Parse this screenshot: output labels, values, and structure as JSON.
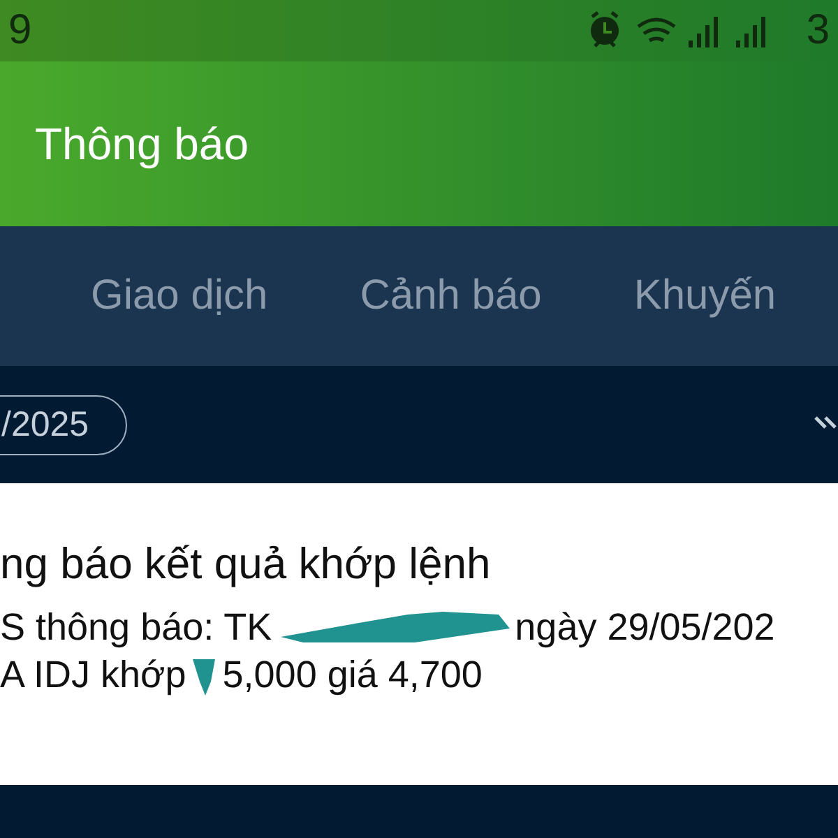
{
  "status_bar": {
    "time": "9",
    "battery": "3"
  },
  "header": {
    "title": "Thông báo"
  },
  "tabs": [
    {
      "label": "Giao dịch",
      "selected": false
    },
    {
      "label": "Cảnh báo",
      "selected": false
    },
    {
      "label": "Khuyến",
      "selected": false
    }
  ],
  "date_filter": {
    "label": "/2025"
  },
  "notification": {
    "title": "ng báo kết quả khớp lệnh",
    "lines": [
      [
        {
          "kind": "text",
          "text": "S thông báo: TK"
        },
        {
          "kind": "redaction"
        },
        {
          "kind": "text",
          "text": "ngày 29/05/202"
        }
      ],
      [
        {
          "kind": "text",
          "text": "A IDJ khớp"
        },
        {
          "kind": "redaction"
        },
        {
          "kind": "text",
          "text": "5,000 giá 4,700"
        }
      ]
    ]
  }
}
